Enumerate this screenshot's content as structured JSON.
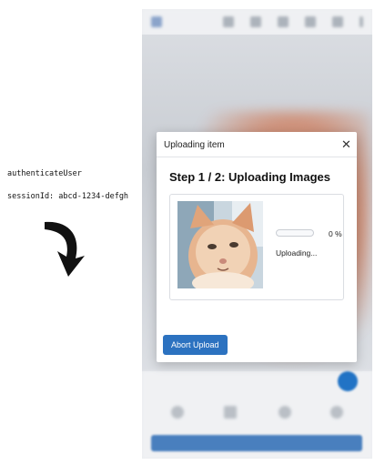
{
  "annotations": {
    "function_name": "authenticateUser",
    "session_line": "sessionId: abcd-1234-defgh"
  },
  "modal": {
    "title": "Uploading item",
    "close_glyph": "✕",
    "step_title": "Step 1 / 2: Uploading Images",
    "progress_percent": 0,
    "progress_label": "0 %",
    "status": "Uploading...",
    "abort_label": "Abort Upload"
  },
  "icons": {
    "close": "close-icon",
    "arrow": "curved-arrow-icon"
  },
  "colors": {
    "accent": "#2c72c0",
    "text": "#222222"
  }
}
